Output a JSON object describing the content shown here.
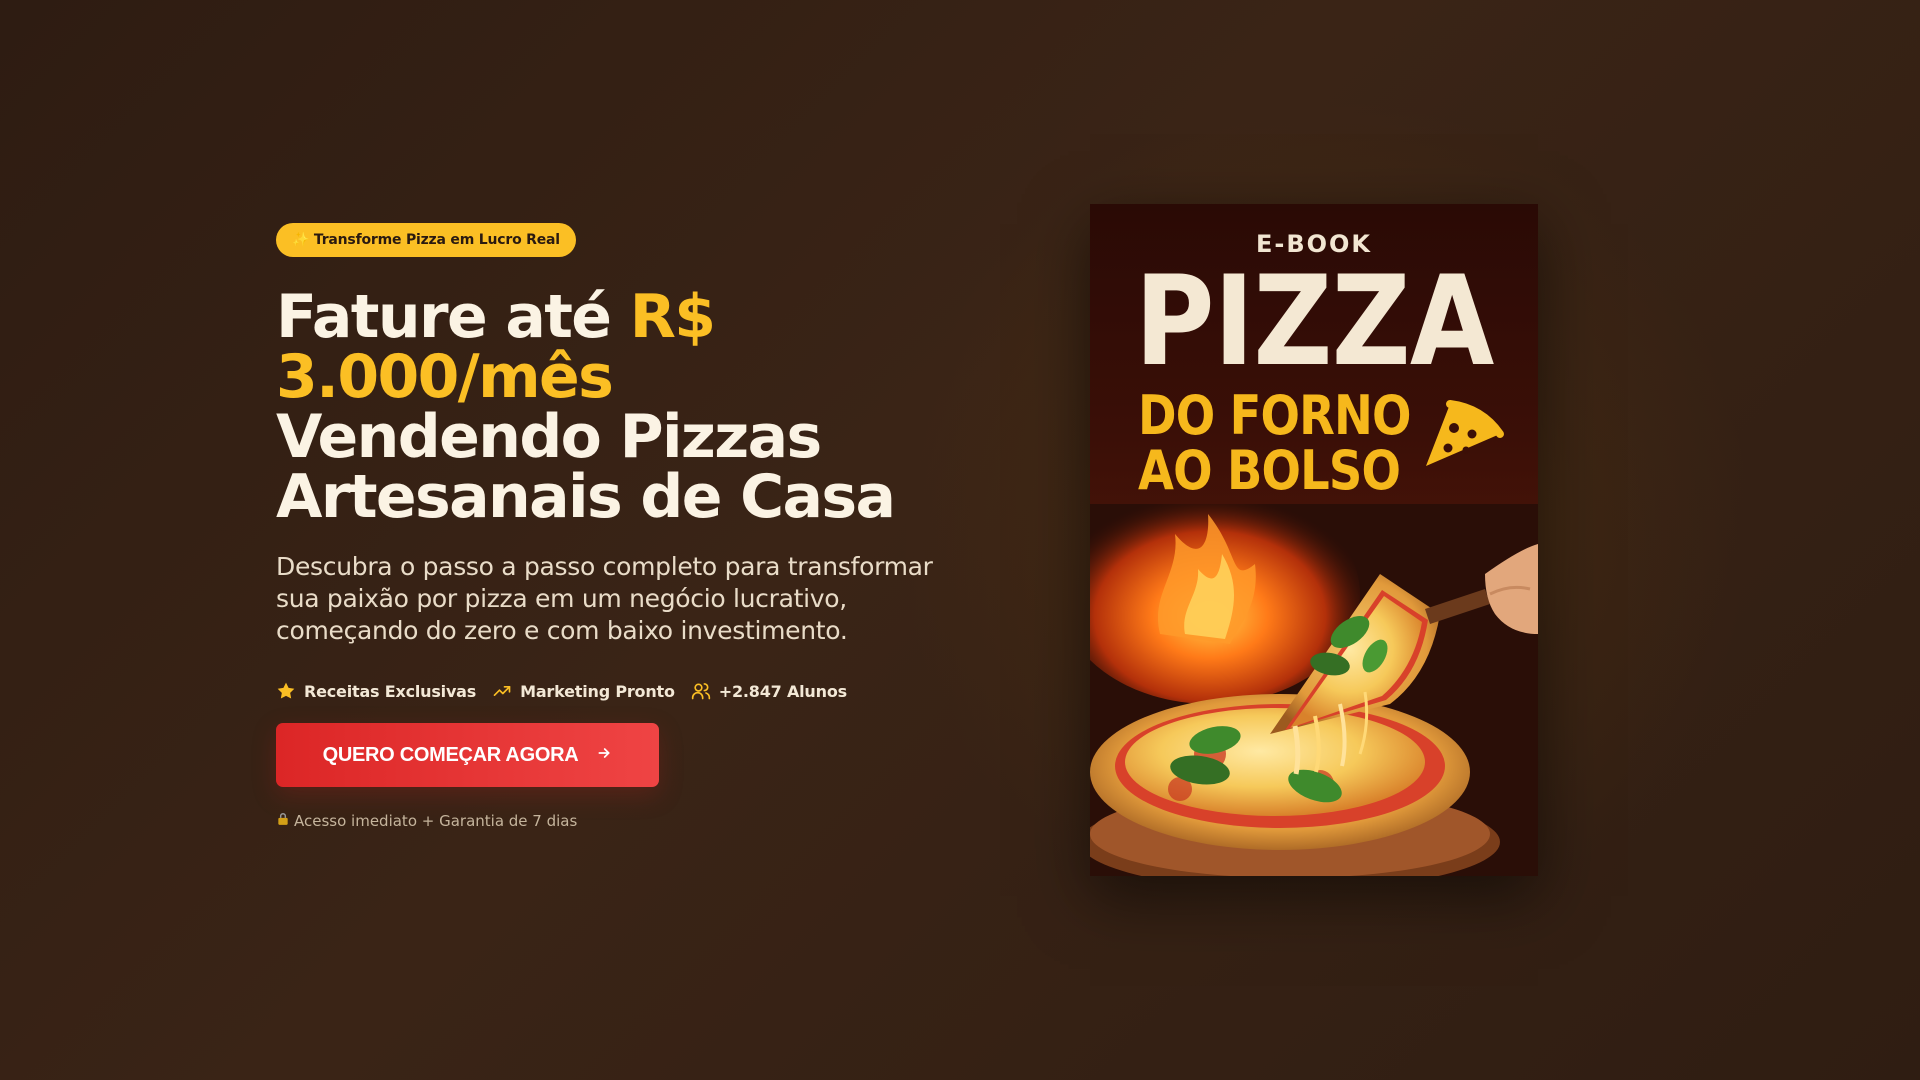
{
  "badge": {
    "icon": "sparkles-icon",
    "text": "✨ Transforme Pizza em Lucro Real"
  },
  "headline": {
    "part1": "Fature até ",
    "accent": "R$ 3.000/mês",
    "part2": "Vendendo Pizzas Artesanais de Casa"
  },
  "description": "Descubra o passo a passo completo para transformar sua paixão por pizza em um negócio lucrativo, começando do zero e com baixo investimento.",
  "features": [
    {
      "icon": "star-icon",
      "label": "Receitas Exclusivas"
    },
    {
      "icon": "trending-up-icon",
      "label": "Marketing Pronto"
    },
    {
      "icon": "users-icon",
      "label": "+2.847 Alunos"
    }
  ],
  "cta": {
    "label": "QUERO COMEÇAR AGORA",
    "icon": "arrow-right-icon"
  },
  "note": {
    "icon": "lock-icon",
    "text": "Acesso imediato + Garantia de 7 dias"
  },
  "cover": {
    "label": "E-BOOK",
    "title": "PIZZA",
    "subtitle_line1": "DO FORNO",
    "subtitle_line2": "AO BOLSO"
  },
  "colors": {
    "accent": "#fbbf24",
    "cta": "#dc2626",
    "background": "#3a2416",
    "text": "#fbf3e4"
  }
}
